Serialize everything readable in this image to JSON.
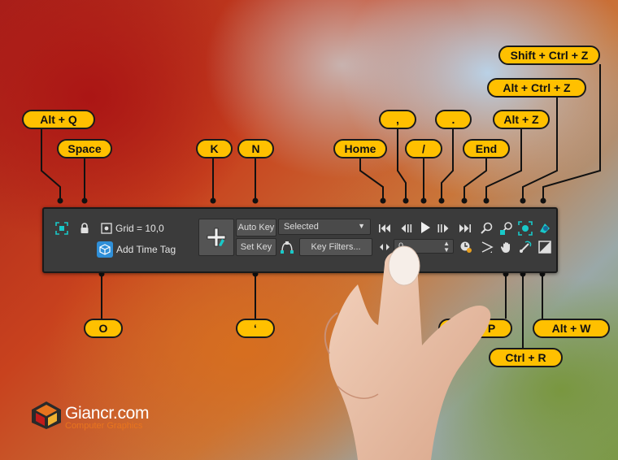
{
  "toolbar": {
    "grid_label": "Grid = 10,0",
    "add_time_tag_label": "Add Time Tag",
    "auto_key_label": "Auto Key",
    "set_key_label": "Set Key",
    "key_mode_value": "Selected",
    "key_filters_label": "Key Filters...",
    "frame_value": "0"
  },
  "shortcuts": {
    "isolate": "Alt + Q",
    "lock_selection": "Space",
    "grid": "O",
    "set_key": "K",
    "auto_key": "N",
    "key_filter_toggle": "‘",
    "go_to_start": "Home",
    "prev_frame": ",",
    "play": "/",
    "next_frame": ".",
    "go_to_end": "End",
    "zoom_extents": "Alt + Z",
    "undo_view": "Alt + Ctrl + Z",
    "redo_view": "Shift + Ctrl + Z",
    "pan": "Ctrl + P",
    "orbit": "Ctrl + R",
    "maximize_viewport": "Alt + W"
  },
  "logo": {
    "name": "Giancr",
    "domain_suffix": ".com",
    "subtitle": "Computer Graphics"
  },
  "colors": {
    "pill": "#ffc000",
    "toolbar": "#3b3b3b",
    "accent_teal": "#19c8c8",
    "logo_orange": "#e8741e"
  }
}
